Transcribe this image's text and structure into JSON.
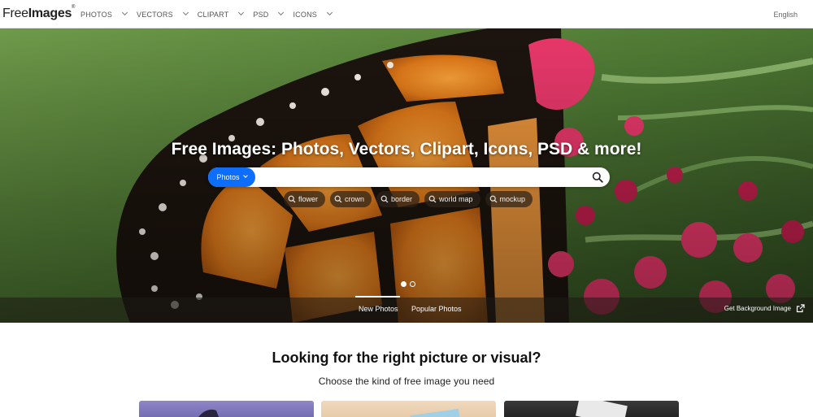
{
  "logo": {
    "text_regular": "Free",
    "text_bold": "Images",
    "mark": "®"
  },
  "nav": {
    "items": [
      {
        "label": "PHOTOS"
      },
      {
        "label": "VECTORS"
      },
      {
        "label": "CLIPART"
      },
      {
        "label": "PSD"
      },
      {
        "label": "ICONS"
      }
    ],
    "language": "English"
  },
  "hero": {
    "title": "Free Images: Photos, Vectors, Clipart, Icons, PSD & more!",
    "search": {
      "type_label": "Photos",
      "value": "",
      "placeholder": ""
    },
    "tags": [
      "flower",
      "crown",
      "border",
      "world map",
      "mockup"
    ],
    "slides": {
      "count": 2,
      "active": 0
    },
    "tabs": {
      "new": "New Photos",
      "popular": "Popular Photos",
      "active": "New Photos"
    },
    "background_link": "Get Background Image"
  },
  "content": {
    "heading": "Looking for the right picture or visual?",
    "subheading": "Choose the kind of free image you need"
  },
  "colors": {
    "accent": "#0d6efd",
    "nav_text": "#555555",
    "hero_overlay": "#1e1914"
  },
  "icons": {
    "search": "magnifier-icon",
    "dropdown": "chevron-down-icon",
    "external": "external-link-icon"
  }
}
